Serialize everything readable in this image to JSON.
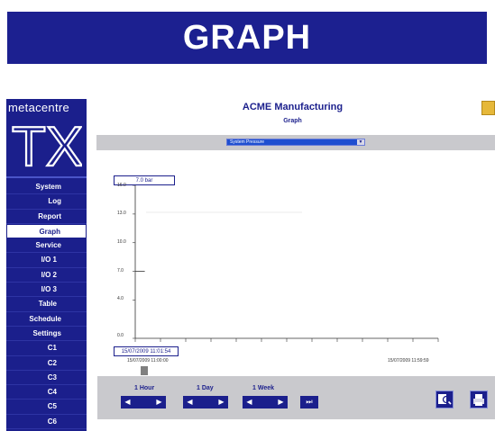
{
  "banner": {
    "title": "GRAPH"
  },
  "logo": {
    "text": "metacentre",
    "mark": "TX"
  },
  "sidebar": {
    "items": [
      {
        "label": "System"
      },
      {
        "label": "Log"
      },
      {
        "label": "Report"
      },
      {
        "label": "Graph"
      },
      {
        "label": "Service"
      },
      {
        "label": "I/O 1"
      },
      {
        "label": "I/O 2"
      },
      {
        "label": "I/O 3"
      },
      {
        "label": "Table"
      },
      {
        "label": "Schedule"
      },
      {
        "label": "Settings"
      },
      {
        "label": "C1"
      },
      {
        "label": "C2"
      },
      {
        "label": "C3"
      },
      {
        "label": "C4"
      },
      {
        "label": "C5"
      },
      {
        "label": "C6"
      }
    ],
    "active": "Graph"
  },
  "header": {
    "app_title": "ACME Manufacturing",
    "page_title": "Graph"
  },
  "selector": {
    "value": "System Pressure"
  },
  "graph": {
    "current_value": "7.0 bar",
    "cursor_time": "15/07/2009 11:01:54",
    "x_start": "15/07/2009 11:00:00",
    "x_end": "15/07/2009 11:59:59",
    "y_ticks": [
      "16.0",
      "13.0",
      "10.0",
      "7.0",
      "4.0",
      "0.0"
    ]
  },
  "chart_data": {
    "type": "line",
    "x": [
      "15/07/2009 11:00:00",
      "15/07/2009 11:01:54"
    ],
    "series": [
      {
        "values": [
          7.0,
          7.0
        ]
      }
    ],
    "ylim": [
      0,
      16
    ],
    "grid": false
  },
  "controls": {
    "hour_label": "1 Hour",
    "day_label": "1 Day",
    "week_label": "1 Week",
    "prev_icon": "◀",
    "next_icon": "▶",
    "ff_icon": "⏭"
  },
  "colors": {
    "brand_blue": "#1b1f8c",
    "banner_blue": "#1c2090",
    "select_blue": "#1f4fd0",
    "panel_grey": "#c9c9cd"
  }
}
